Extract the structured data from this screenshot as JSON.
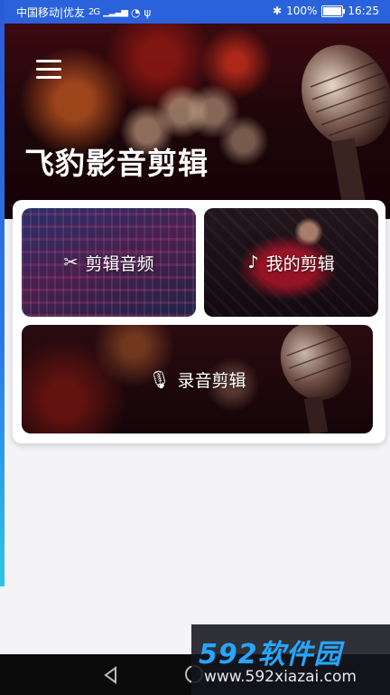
{
  "status_bar": {
    "carrier": "中国移动|优友",
    "network": "2G",
    "battery": "100%",
    "time": "16:25"
  },
  "header": {
    "title": "飞豹影音剪辑"
  },
  "tiles": {
    "cut_audio": "剪辑音频",
    "my_edits": "我的剪辑",
    "record_edit": "录音剪辑"
  },
  "watermark": {
    "title": "592软件园",
    "url": "www.592xiazai.com"
  },
  "icons": {
    "menu": "menu-icon",
    "scissors": "scissors-icon",
    "note": "music-note-icon",
    "microphone": "microphone-icon"
  },
  "colors": {
    "status_bar": "#2a62dc",
    "watermark_accent": "#25a7ff"
  }
}
